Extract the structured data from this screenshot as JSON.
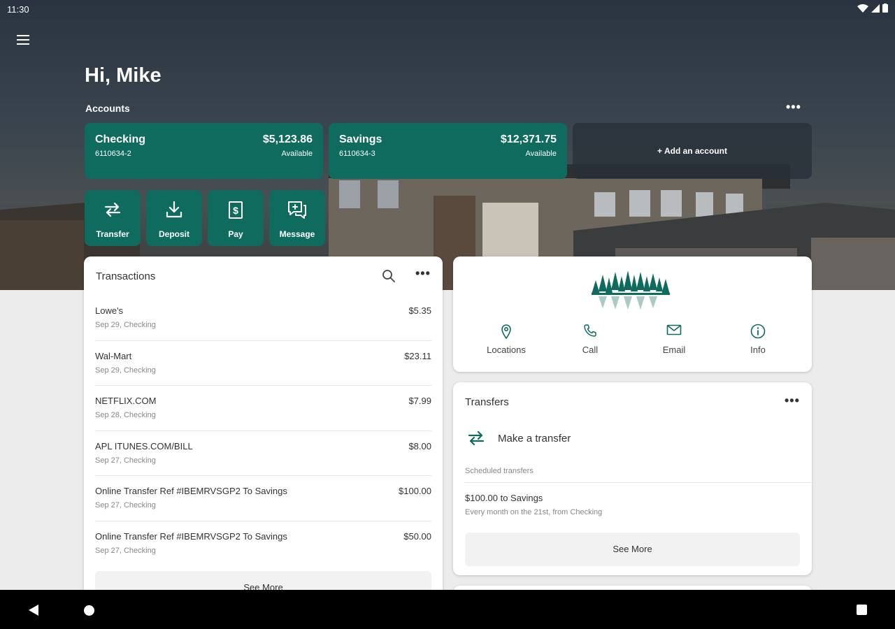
{
  "status_bar": {
    "time": "11:30"
  },
  "greeting": "Hi, Mike",
  "accounts": {
    "label": "Accounts",
    "more": "•••",
    "items": [
      {
        "name": "Checking",
        "number": "6110634-2",
        "balance": "$5,123.86",
        "balance_label": "Available"
      },
      {
        "name": "Savings",
        "number": "6110634-3",
        "balance": "$12,371.75",
        "balance_label": "Available"
      }
    ],
    "add_label": "+ Add an account"
  },
  "quick_actions": [
    {
      "label": "Transfer",
      "icon": "transfer-icon"
    },
    {
      "label": "Deposit",
      "icon": "deposit-icon"
    },
    {
      "label": "Pay",
      "icon": "pay-icon"
    },
    {
      "label": "Message",
      "icon": "message-icon"
    }
  ],
  "transactions": {
    "title": "Transactions",
    "more": "•••",
    "items": [
      {
        "description": "Lowe's",
        "amount": "$5.35",
        "meta": "Sep 29, Checking"
      },
      {
        "description": "Wal-Mart",
        "amount": "$23.11",
        "meta": "Sep 29, Checking"
      },
      {
        "description": "NETFLIX.COM",
        "amount": "$7.99",
        "meta": "Sep 28, Checking"
      },
      {
        "description": "APL ITUNES.COM/BILL",
        "amount": "$8.00",
        "meta": "Sep 27, Checking"
      },
      {
        "description": "Online Transfer Ref #IBEMRVSGP2 To Savings",
        "amount": "$100.00",
        "meta": "Sep 27, Checking"
      },
      {
        "description": "Online Transfer Ref #IBEMRVSGP2 To Savings",
        "amount": "$50.00",
        "meta": "Sep 27, Checking"
      }
    ],
    "see_more": "See More"
  },
  "contact": {
    "items": [
      {
        "label": "Locations",
        "icon": "location-pin-icon"
      },
      {
        "label": "Call",
        "icon": "phone-icon"
      },
      {
        "label": "Email",
        "icon": "email-icon"
      },
      {
        "label": "Info",
        "icon": "info-icon"
      }
    ]
  },
  "transfers": {
    "title": "Transfers",
    "more": "•••",
    "make_transfer": "Make a transfer",
    "scheduled_label": "Scheduled transfers",
    "scheduled": [
      {
        "title": "$100.00 to Savings",
        "subtitle": "Every month on the 21st, from Checking"
      }
    ],
    "see_more": "See More"
  },
  "colors": {
    "brand": "#0e6b5e",
    "background": "#ececec"
  }
}
